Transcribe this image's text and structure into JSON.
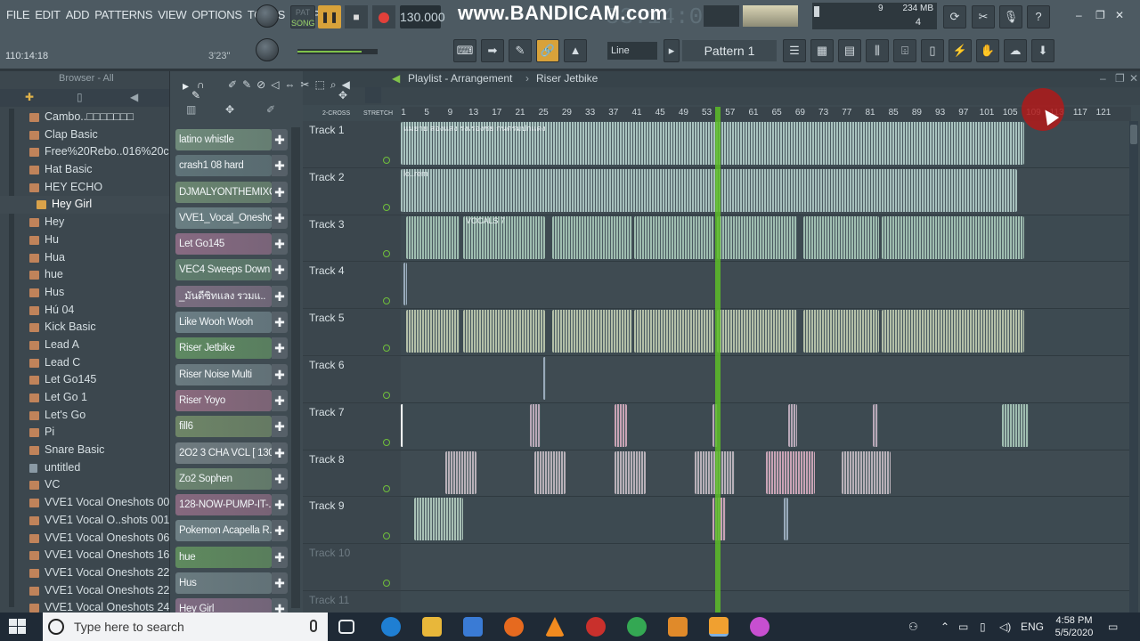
{
  "menu": [
    "FILE",
    "EDIT",
    "ADD",
    "PATTERNS",
    "VIEW",
    "OPTIONS",
    "TOOLS",
    "HELP"
  ],
  "transport": {
    "pat_label": "PAT",
    "song_label": "SONG",
    "tempo": "130.000",
    "time": "53:14:00",
    "hint": "110:14:18",
    "hint2": "3'23\""
  },
  "watermark": "www.BANDICAM.com",
  "cpu": {
    "mem": "234 MB",
    "num": "9",
    "poly": "4"
  },
  "snap": {
    "label": "Line"
  },
  "pattern": {
    "label": "Pattern 1"
  },
  "browser": {
    "title": "Browser - All",
    "items": [
      {
        "label": "Cambo..□□□□□□□",
        "kind": "folder"
      },
      {
        "label": "Clap Basic",
        "kind": "folder"
      },
      {
        "label": "Free%20Rebo..016%20copy",
        "kind": "folder"
      },
      {
        "label": "Hat Basic",
        "kind": "folder"
      },
      {
        "label": "HEY ECHO",
        "kind": "folder"
      },
      {
        "label": "Hey Girl",
        "kind": "open"
      },
      {
        "label": "Hey",
        "kind": "folder"
      },
      {
        "label": "Hu",
        "kind": "folder"
      },
      {
        "label": "Hua",
        "kind": "folder"
      },
      {
        "label": "hue",
        "kind": "folder"
      },
      {
        "label": "Hus",
        "kind": "folder"
      },
      {
        "label": "Hú 04",
        "kind": "folder"
      },
      {
        "label": "Kick Basic",
        "kind": "folder"
      },
      {
        "label": "Lead A",
        "kind": "folder"
      },
      {
        "label": "Lead C",
        "kind": "folder"
      },
      {
        "label": "Let Go145",
        "kind": "folder"
      },
      {
        "label": "Let Go 1",
        "kind": "folder"
      },
      {
        "label": "Let's Go",
        "kind": "folder"
      },
      {
        "label": "Pi",
        "kind": "folder"
      },
      {
        "label": "Snare Basic",
        "kind": "folder"
      },
      {
        "label": "untitled",
        "kind": "file"
      },
      {
        "label": "VC",
        "kind": "folder"
      },
      {
        "label": "VVE1 Vocal Oneshots 001",
        "kind": "folder"
      },
      {
        "label": "VVE1 Vocal O..shots 001_17",
        "kind": "folder"
      },
      {
        "label": "VVE1 Vocal Oneshots 067",
        "kind": "folder"
      },
      {
        "label": "VVE1 Vocal Oneshots 160",
        "kind": "folder"
      },
      {
        "label": "VVE1 Vocal Oneshots 223",
        "kind": "folder"
      },
      {
        "label": "VVE1 Vocal Oneshots 228",
        "kind": "folder"
      },
      {
        "label": "VVE1 Vocal Oneshots 24",
        "kind": "folder"
      }
    ]
  },
  "channels": [
    {
      "label": "latino whistle",
      "color": "#6f8a7a"
    },
    {
      "label": "crash1 08 hard",
      "color": "#5f7378"
    },
    {
      "label": "DJMALYONTHEMIXOKL..",
      "color": "#6a8570"
    },
    {
      "label": "VVE1_Vocal_Oneshot..",
      "color": "#6a7f83"
    },
    {
      "label": "Let Go145",
      "color": "#876a82"
    },
    {
      "label": "VEC4 Sweeps Down 18",
      "color": "#5f7d6d"
    },
    {
      "label": "_มันดีซิทแลง รวมแ..",
      "color": "#7a6d80"
    },
    {
      "label": "Like Wooh Wooh",
      "color": "#6b7e85"
    },
    {
      "label": "Riser Jetbike",
      "color": "#5f8a62"
    },
    {
      "label": "Riser Noise Multi",
      "color": "#6a7a80"
    },
    {
      "label": "Riser Yoyo",
      "color": "#8a6a7e"
    },
    {
      "label": "fill6",
      "color": "#6e8567"
    },
    {
      "label": "2O2 3 CHA VCL [ 130 ]..",
      "color": "#6f7b80"
    },
    {
      "label": "Zo2 Sophen",
      "color": "#6b8470"
    },
    {
      "label": "128-NOW-PUMP-IT-..",
      "color": "#86697f"
    },
    {
      "label": "Pokemon Acapella R..",
      "color": "#6d7f84"
    },
    {
      "label": "hue",
      "color": "#5f8a5e"
    },
    {
      "label": "Hus",
      "color": "#6a7b80"
    },
    {
      "label": "Hey Girl",
      "color": "#7f6b82"
    }
  ],
  "playlist": {
    "title": "Playlist - Arrangement",
    "crumb": "Riser Jetbike",
    "labels": {
      "cross": "2-CROSS",
      "stretch": "STRETCH"
    },
    "bars": [
      "1",
      "5",
      "9",
      "13",
      "17",
      "21",
      "25",
      "29",
      "33",
      "37",
      "41",
      "45",
      "49",
      "53",
      "57",
      "61",
      "65",
      "69",
      "73",
      "77",
      "81",
      "85",
      "89",
      "93",
      "97",
      "101",
      "105",
      "109",
      "113",
      "117",
      "121"
    ],
    "tracks": [
      "Track 1",
      "Track 2",
      "Track 3",
      "Track 4",
      "Track 5",
      "Track 6",
      "Track 7",
      "Track 8",
      "Track 9",
      "Track 10",
      "Track 11"
    ],
    "clip_text": {
      "t1": "แมยาย สองแสง รงเรองชย กนตรมปกแดง",
      "t2": "lo..rem",
      "t3": "VOCALS 7"
    }
  },
  "taskbar": {
    "search": "Type here to search",
    "lang": "ENG",
    "time": "4:58 PM",
    "date": "5/5/2020"
  }
}
